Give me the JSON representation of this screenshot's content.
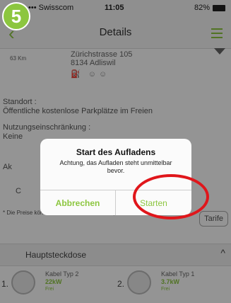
{
  "step": "5",
  "statusbar": {
    "carrier": "••• Swisscom",
    "wifi": "wifi-icon",
    "time": "11:05",
    "right": "82%"
  },
  "navbar": {
    "title": "Details"
  },
  "station": {
    "distance": "63 Km",
    "street": "Zürichstrasse 105",
    "city": "8134 Adliswil",
    "icons": "⛽ ☺☺"
  },
  "info": {
    "standort_label": "Standort :",
    "standort_value": "Öffentliche kostenlose Parkplätze im Freien",
    "nutzung_label": "Nutzungseinschränkung :",
    "nutzung_value": "Keine",
    "ak_fragment": "Ak",
    "c_fragment": "C",
    "note": "* Die Preise können sich ändern. Siehe Tarifplan.",
    "tariff_button": "Tarife"
  },
  "section": {
    "title": "Hauptsteckdose",
    "chevron": "^"
  },
  "plugs": [
    {
      "num": "1.",
      "name": "Kabel Typ 2",
      "power": "22kW",
      "status": "Frei"
    },
    {
      "num": "2.",
      "name": "Kabel Typ 1",
      "power": "3.7kW",
      "status": "Frei"
    }
  ],
  "dialog": {
    "title": "Start des Aufladens",
    "message": "Achtung, das Aufladen steht unmittelbar bevor.",
    "cancel": "Abbrechen",
    "confirm": "Starten"
  },
  "colors": {
    "accent": "#8cc63f",
    "highlight": "#e0161b"
  }
}
